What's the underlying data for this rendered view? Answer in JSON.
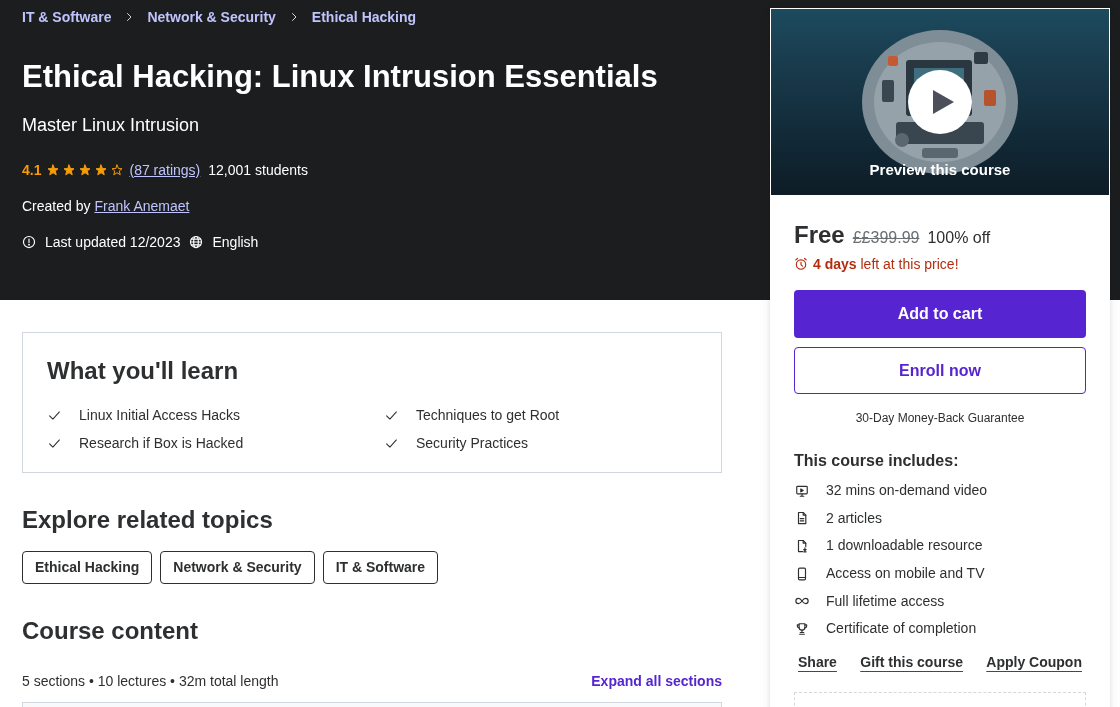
{
  "breadcrumbs": [
    "IT & Software",
    "Network & Security",
    "Ethical Hacking"
  ],
  "course": {
    "title": "Ethical Hacking: Linux Intrusion Essentials",
    "subtitle": "Master Linux Intrusion",
    "rating": "4.1",
    "stars": 4,
    "ratings_link": "(87 ratings)",
    "students": "12,001 students",
    "created_by": "Created by",
    "author": "Frank Anemaet",
    "last_updated": "Last updated 12/2023",
    "language": "English"
  },
  "what_youll_learn": {
    "heading": "What you'll learn",
    "items": [
      "Linux Initial Access Hacks",
      "Techniques to get Root",
      "Research if Box is Hacked",
      "Security Practices"
    ]
  },
  "related_topics": {
    "heading": "Explore related topics",
    "tags": [
      "Ethical Hacking",
      "Network & Security",
      "IT & Software"
    ]
  },
  "course_content": {
    "heading": "Course content",
    "summary": "5 sections • 10 lectures • 32m total length",
    "expand_link": "Expand all sections"
  },
  "purchase_card": {
    "preview_label": "Preview this course",
    "price": "Free",
    "original_price": "££399.99",
    "discount": "100% off",
    "deadline": "**4 days** left at this price!",
    "add_to_cart": "Add to cart",
    "enroll": "Enroll now",
    "guarantee": "30-Day Money-Back Guarantee",
    "includes_heading": "This course includes:",
    "includes": [
      {
        "kind": "video",
        "label": "32 mins on-demand video"
      },
      {
        "kind": "article",
        "label": "2 articles"
      },
      {
        "kind": "download",
        "label": "1 downloadable resource"
      },
      {
        "kind": "mobile",
        "label": "Access on mobile and TV"
      },
      {
        "kind": "lifetime",
        "label": "Full lifetime access"
      },
      {
        "kind": "certificate",
        "label": "Certificate of completion"
      }
    ],
    "actions": [
      "Share",
      "Gift this course",
      "Apply Coupon"
    ]
  }
}
